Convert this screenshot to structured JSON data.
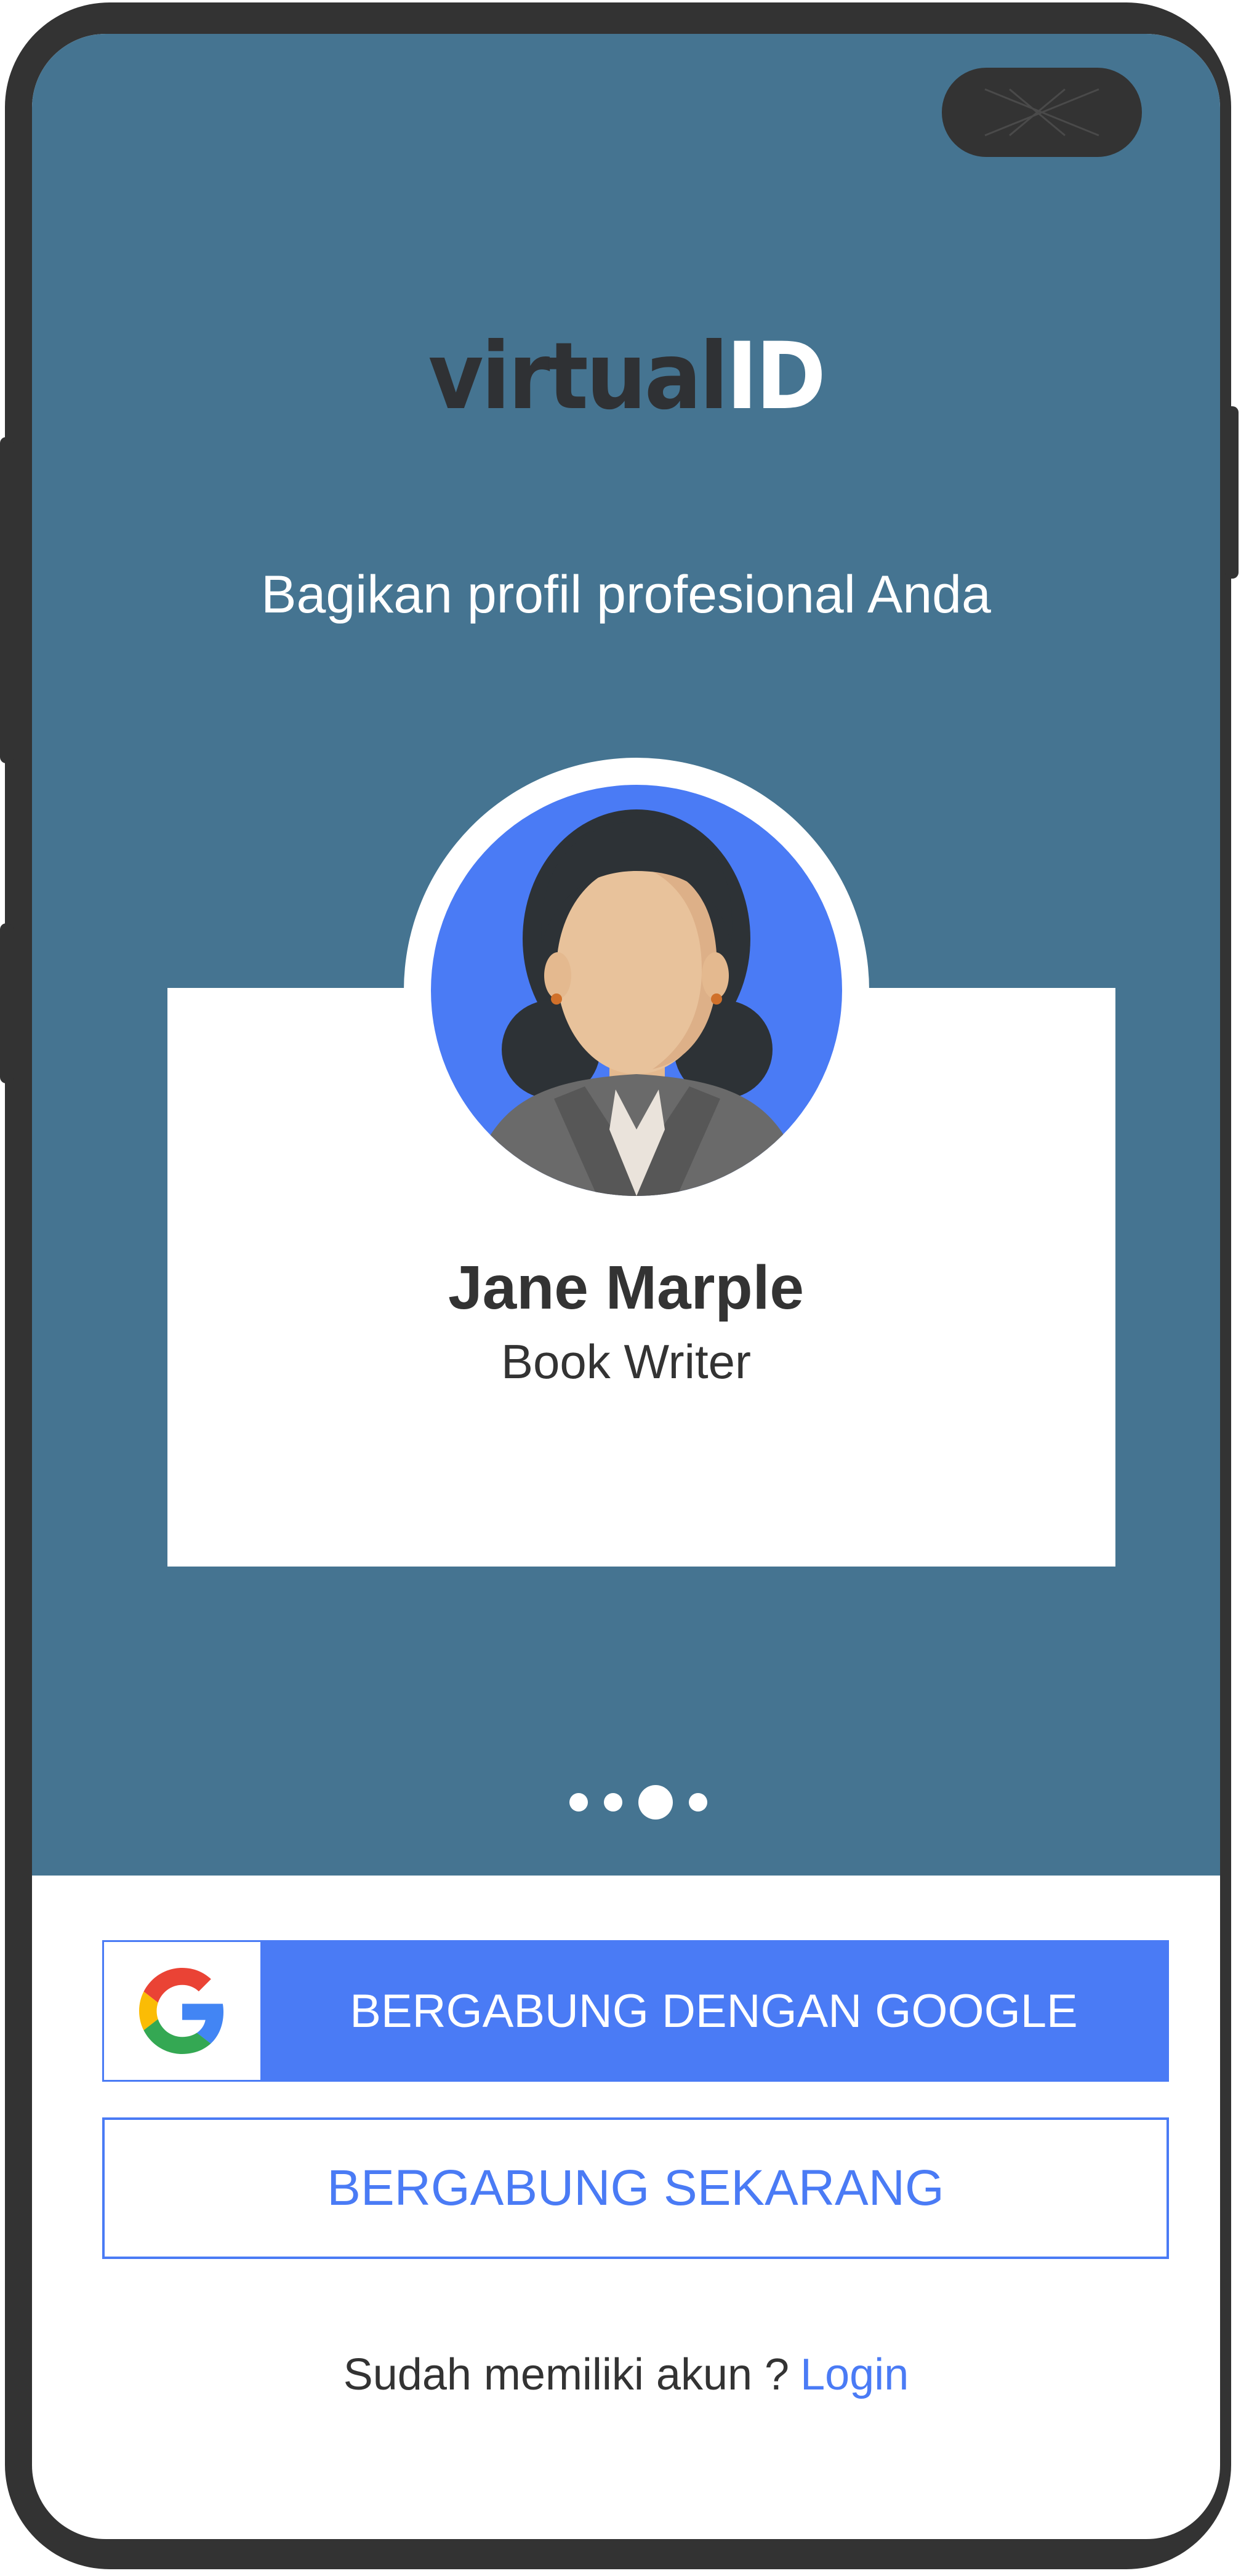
{
  "app": {
    "logo_part1": "virtual",
    "logo_part2": "ID",
    "tagline": "Bagikan profil profesional Anda"
  },
  "profile": {
    "name": "Jane Marple",
    "role": "Book Writer"
  },
  "pager": {
    "total": 4,
    "active_index": 2
  },
  "actions": {
    "google_button_label": "BERGABUNG DENGAN GOOGLE",
    "google_icon": "google-g-icon",
    "join_button_label": "BERGABUNG SEKARANG",
    "have_account_text": "Sudah memiliki akun ?",
    "login_link_label": "Login"
  },
  "colors": {
    "hero_background": "#457491",
    "accent_blue": "#4a7bf5",
    "text_dark": "#333333",
    "frame": "#333333"
  }
}
